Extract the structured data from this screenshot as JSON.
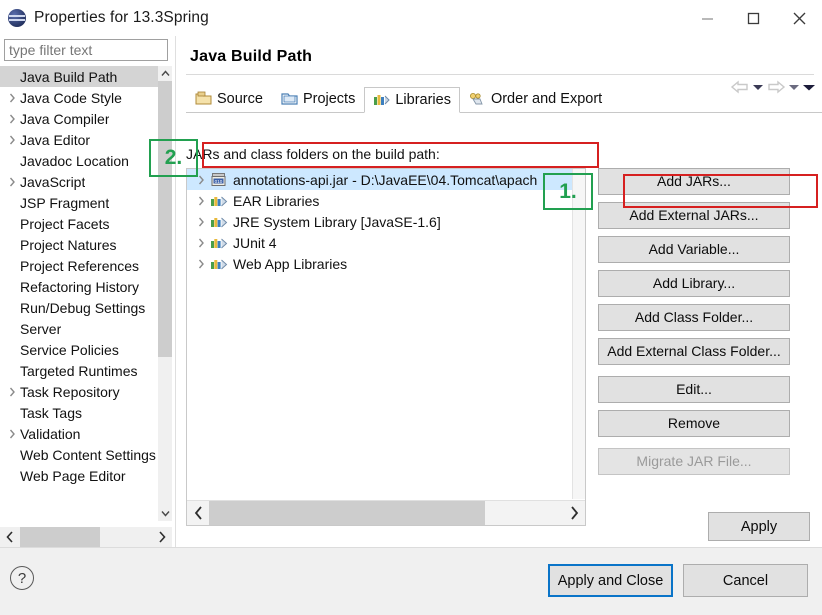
{
  "window": {
    "title": "Properties for 13.3Spring",
    "icon": "eclipse-globe-icon",
    "minimize": "minimize-button",
    "maximize": "maximize-button",
    "close": "close-button"
  },
  "filter": {
    "placeholder": "type filter text",
    "value": ""
  },
  "sidebar": {
    "items": [
      {
        "label": "Java Build Path",
        "expandable": false,
        "selected": true
      },
      {
        "label": "Java Code Style",
        "expandable": true,
        "selected": false
      },
      {
        "label": "Java Compiler",
        "expandable": true,
        "selected": false
      },
      {
        "label": "Java Editor",
        "expandable": true,
        "selected": false
      },
      {
        "label": "Javadoc Location",
        "expandable": false,
        "selected": false
      },
      {
        "label": "JavaScript",
        "expandable": true,
        "selected": false
      },
      {
        "label": "JSP Fragment",
        "expandable": false,
        "selected": false
      },
      {
        "label": "Project Facets",
        "expandable": false,
        "selected": false
      },
      {
        "label": "Project Natures",
        "expandable": false,
        "selected": false
      },
      {
        "label": "Project References",
        "expandable": false,
        "selected": false
      },
      {
        "label": "Refactoring History",
        "expandable": false,
        "selected": false
      },
      {
        "label": "Run/Debug Settings",
        "expandable": false,
        "selected": false
      },
      {
        "label": "Server",
        "expandable": false,
        "selected": false
      },
      {
        "label": "Service Policies",
        "expandable": false,
        "selected": false
      },
      {
        "label": "Targeted Runtimes",
        "expandable": false,
        "selected": false
      },
      {
        "label": "Task Repository",
        "expandable": true,
        "selected": false
      },
      {
        "label": "Task Tags",
        "expandable": false,
        "selected": false
      },
      {
        "label": "Validation",
        "expandable": true,
        "selected": false
      },
      {
        "label": "Web Content Settings",
        "expandable": false,
        "selected": false
      },
      {
        "label": "Web Page Editor",
        "expandable": false,
        "selected": false
      }
    ]
  },
  "main": {
    "page_title": "Java Build Path",
    "nav": {
      "back": "back-arrow-icon",
      "back_menu": "back-dropdown-icon",
      "forward": "forward-arrow-icon",
      "forward_menu": "forward-dropdown-icon",
      "view_menu": "view-menu-icon"
    },
    "tabs": [
      {
        "label": "Source",
        "icon": "source-folder-icon",
        "active": false
      },
      {
        "label": "Projects",
        "icon": "projects-folder-icon",
        "active": false
      },
      {
        "label": "Libraries",
        "icon": "libraries-icon",
        "active": true
      },
      {
        "label": "Order and Export",
        "icon": "order-export-icon",
        "active": false
      }
    ],
    "content_label": "JARs and class folders on the build path:",
    "jar_entries": [
      {
        "label": "annotations-api.jar - D:\\JavaEE\\04.Tomcat\\apach",
        "icon": "jar-icon",
        "selected": true
      },
      {
        "label": "EAR Libraries",
        "icon": "library-icon",
        "selected": false
      },
      {
        "label": "JRE System Library [JavaSE-1.6]",
        "icon": "library-icon",
        "selected": false
      },
      {
        "label": "JUnit 4",
        "icon": "library-icon",
        "selected": false
      },
      {
        "label": "Web App Libraries",
        "icon": "library-icon",
        "selected": false
      }
    ],
    "buttons": [
      {
        "label": "Add JARs...",
        "disabled": false,
        "gap": false
      },
      {
        "label": "Add External JARs...",
        "disabled": false,
        "gap": false
      },
      {
        "label": "Add Variable...",
        "disabled": false,
        "gap": false
      },
      {
        "label": "Add Library...",
        "disabled": false,
        "gap": false
      },
      {
        "label": "Add Class Folder...",
        "disabled": false,
        "gap": false
      },
      {
        "label": "Add External Class Folder...",
        "disabled": false,
        "gap": false
      },
      {
        "label": "Edit...",
        "disabled": false,
        "gap": true
      },
      {
        "label": "Remove",
        "disabled": false,
        "gap": false
      },
      {
        "label": "Migrate JAR File...",
        "disabled": true,
        "gap": true
      }
    ],
    "apply_label": "Apply"
  },
  "footer": {
    "help": "?",
    "apply_and_close": "Apply and Close",
    "cancel": "Cancel"
  },
  "annotations": {
    "step1": "1.",
    "step2": "2.",
    "red_color": "#d62020",
    "green_color": "#22a050"
  },
  "scrollbars": {
    "left_up": "▲",
    "left_down": "▼",
    "left_h_left": "‹",
    "left_h_right": "›",
    "jar_h_left": "‹",
    "jar_h_right": "›"
  }
}
